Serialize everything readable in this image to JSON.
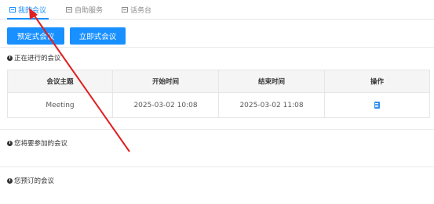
{
  "tabs": [
    {
      "label": "我的会议",
      "active": true
    },
    {
      "label": "自助服务",
      "active": false
    },
    {
      "label": "话务台",
      "active": false
    }
  ],
  "buttons": {
    "schedule": "预定式会议",
    "instant": "立即式会议"
  },
  "sections": {
    "ongoing": "正在进行的会议",
    "upcoming": "您将要参加的会议",
    "booked": "您预订的会议"
  },
  "table": {
    "headers": [
      "会议主题",
      "开始时间",
      "结束时间",
      "操作"
    ],
    "rows": [
      {
        "subject": "Meeting",
        "start": "2025-03-02 10:08",
        "end": "2025-03-02 11:08",
        "action_icon": "document-icon"
      }
    ]
  },
  "colors": {
    "accent": "#1890ff",
    "annotation_arrow": "#e02020"
  }
}
